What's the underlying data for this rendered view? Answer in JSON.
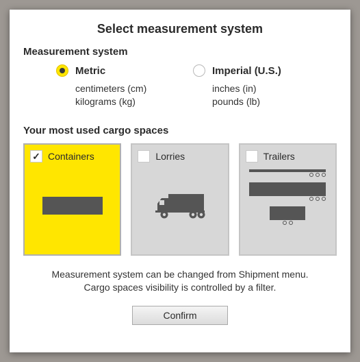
{
  "title": "Select measurement system",
  "measurement": {
    "section_label": "Measurement system",
    "options": [
      {
        "key": "metric",
        "label": "Metric",
        "sub1": "centimeters (cm)",
        "sub2": "kilograms (kg)",
        "selected": true
      },
      {
        "key": "imperial",
        "label": "Imperial (U.S.)",
        "sub1": "inches (in)",
        "sub2": "pounds (lb)",
        "selected": false
      }
    ]
  },
  "cargo": {
    "section_label": "Your most used cargo spaces",
    "cards": [
      {
        "key": "containers",
        "label": "Containers",
        "checked": true
      },
      {
        "key": "lorries",
        "label": "Lorries",
        "checked": false
      },
      {
        "key": "trailers",
        "label": "Trailers",
        "checked": false
      }
    ]
  },
  "hint_line1": "Measurement system can be changed from Shipment menu.",
  "hint_line2": "Cargo spaces visibility is controlled by a filter.",
  "confirm_label": "Confirm"
}
